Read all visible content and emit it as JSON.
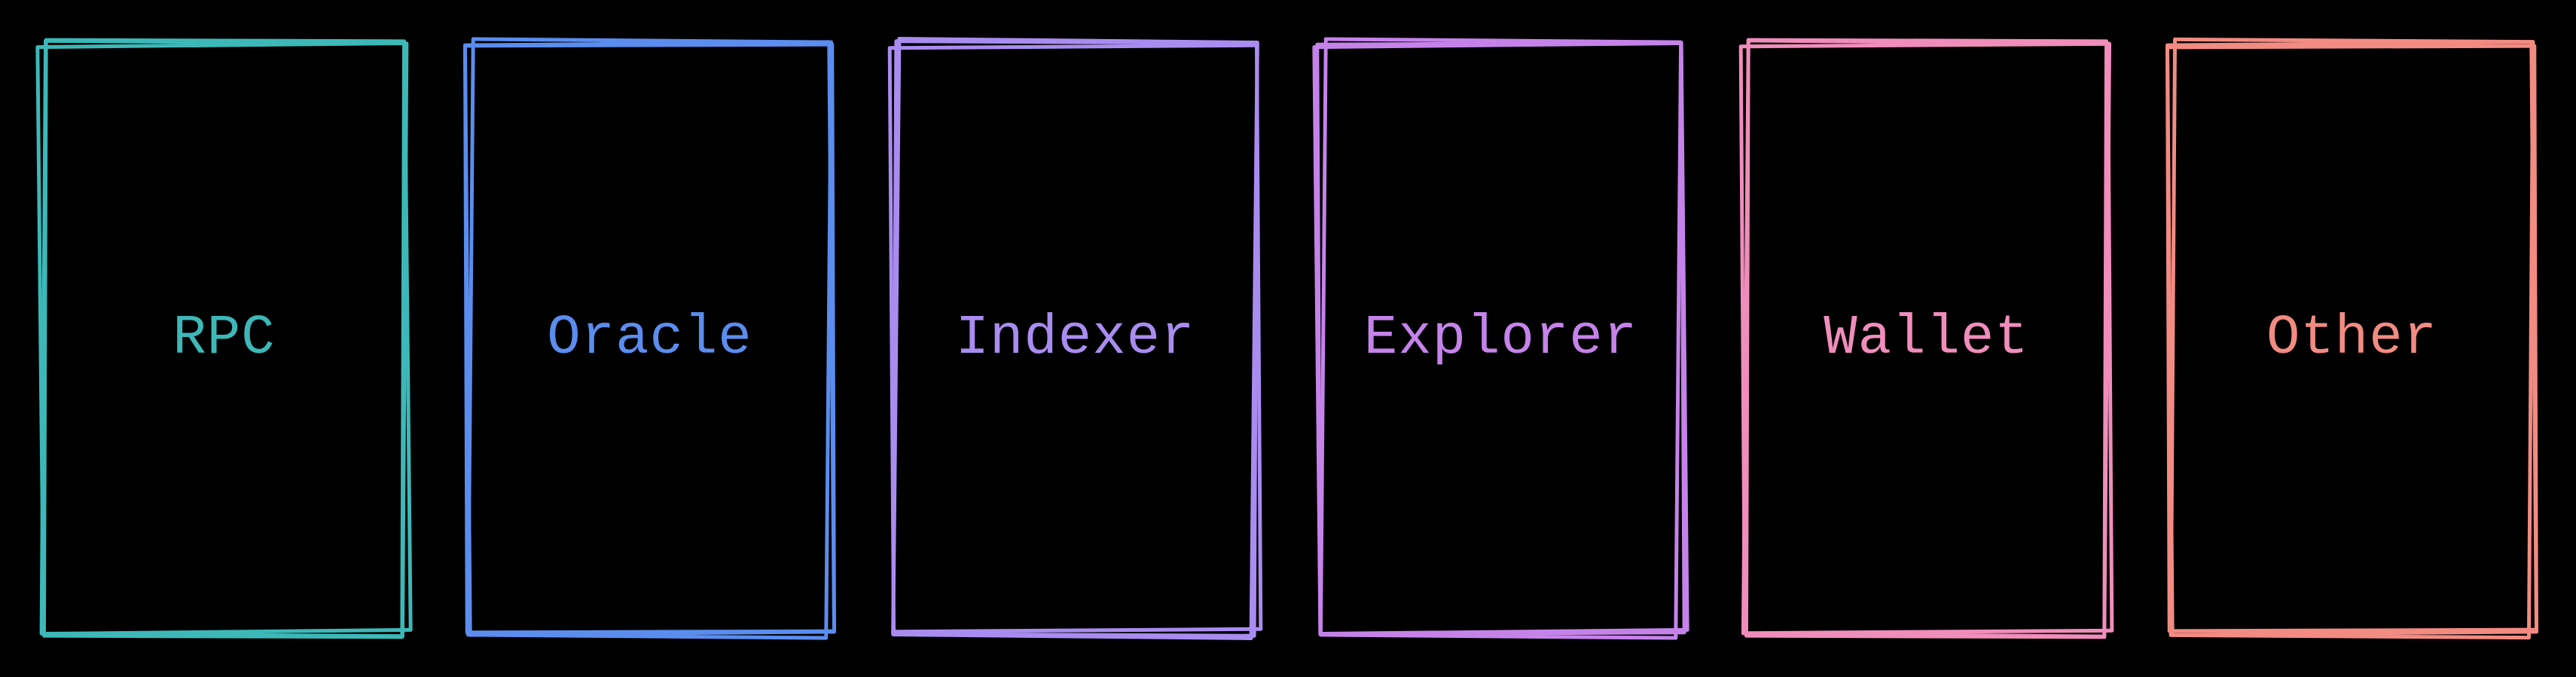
{
  "cards": [
    {
      "id": "rpc",
      "label": "RPC",
      "color": "#3db8b8"
    },
    {
      "id": "oracle",
      "label": "Oracle",
      "color": "#5b8def"
    },
    {
      "id": "indexer",
      "label": "Indexer",
      "color": "#a98cf0"
    },
    {
      "id": "explorer",
      "label": "Explorer",
      "color": "#c583ea"
    },
    {
      "id": "wallet",
      "label": "Wallet",
      "color": "#f08dbb"
    },
    {
      "id": "other",
      "label": "Other",
      "color": "#f28b82"
    }
  ]
}
